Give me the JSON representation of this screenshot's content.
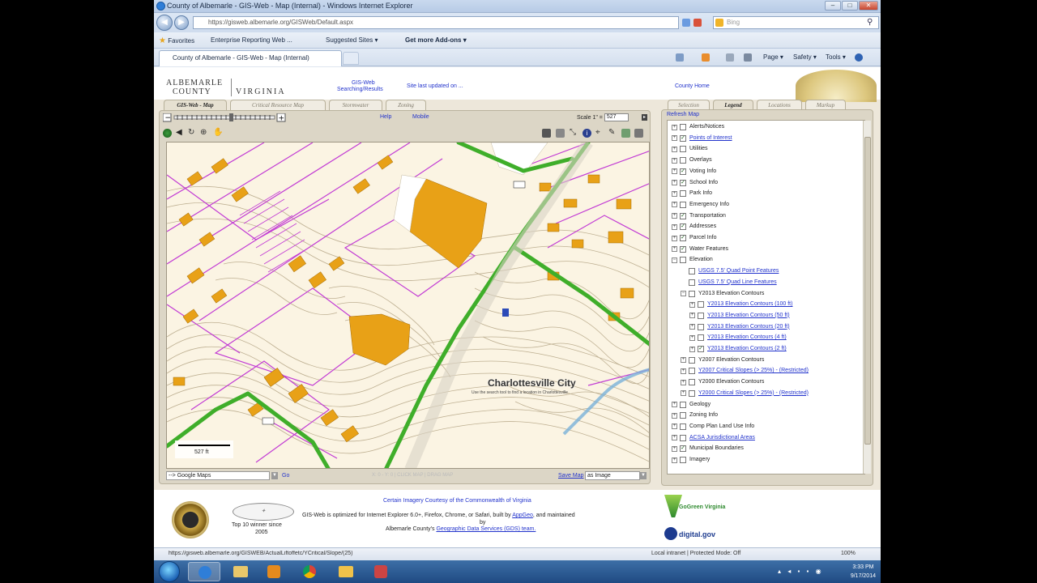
{
  "window": {
    "title": "County of Albemarle - GIS-Web - Map (Internal) - Windows Internet Explorer"
  },
  "browser": {
    "address": "https://gisweb.albemarle.org/GISWeb/Default.aspx",
    "address_domain": "albemarle.org",
    "search_placeholder": "Bing",
    "favorites_label": "Favorites",
    "favorites": [
      "Enterprise Reporting Web ...",
      "Suggested Sites ▾",
      "Get more Add-ons ▾"
    ],
    "tab_label": "County of Albemarle - GIS-Web - Map (Internal)",
    "commands": [
      "Page ▾",
      "Safety ▾",
      "Tools ▾"
    ]
  },
  "header": {
    "logo_line1": "ALBEMARLE",
    "logo_line2": "COUNTY",
    "logo_line3": "VIRGINIA",
    "link_gis": "GIS-Web",
    "link_results": "Searching/Results",
    "link_updated": "Site last updated on ...",
    "link_county_home": "County Home"
  },
  "left_tabs": [
    "GIS-Web - Map",
    "Critical Resource Map",
    "Stormwater",
    "Zoning"
  ],
  "right_tabs": [
    "Selection",
    "Legend",
    "Locations",
    "Markup"
  ],
  "map": {
    "help": "Help",
    "mobile": "Mobile",
    "scale_label": "Scale 1\" =",
    "scale_value": "527",
    "city_label": "Charlottesville City",
    "city_sublabel": "Use the search tool to find a location in Charlottesville",
    "scalebar_label": "527 ft",
    "basemap_select": "--> Google Maps",
    "go": "Go",
    "coords_hint": "X: 0 - Y: 0 | CLICK MAP | DRAG MAP",
    "save_map": "Save Map",
    "as_image": "as Image",
    "refresh_map": "Refresh Map"
  },
  "layers": [
    {
      "label": "Alerts/Notices",
      "indent": 0,
      "pm": "+",
      "checked": false,
      "link": false
    },
    {
      "label": "Points of Interest",
      "indent": 0,
      "pm": "+",
      "checked": true,
      "link": true
    },
    {
      "label": "Utilities",
      "indent": 0,
      "pm": "+",
      "checked": false,
      "link": false
    },
    {
      "label": "Overlays",
      "indent": 0,
      "pm": "+",
      "checked": false,
      "link": false
    },
    {
      "label": "Voting Info",
      "indent": 0,
      "pm": "+",
      "checked": true,
      "link": false
    },
    {
      "label": "School Info",
      "indent": 0,
      "pm": "+",
      "checked": true,
      "link": false
    },
    {
      "label": "Park Info",
      "indent": 0,
      "pm": "+",
      "checked": false,
      "link": false
    },
    {
      "label": "Emergency Info",
      "indent": 0,
      "pm": "+",
      "checked": false,
      "link": false
    },
    {
      "label": "Transportation",
      "indent": 0,
      "pm": "+",
      "checked": true,
      "link": false
    },
    {
      "label": "Addresses",
      "indent": 0,
      "pm": "+",
      "checked": true,
      "link": false
    },
    {
      "label": "Parcel Info",
      "indent": 0,
      "pm": "+",
      "checked": true,
      "link": false
    },
    {
      "label": "Water Features",
      "indent": 0,
      "pm": "+",
      "checked": true,
      "link": false
    },
    {
      "label": "Elevation",
      "indent": 0,
      "pm": "−",
      "checked": false,
      "link": false
    },
    {
      "label": "USGS 7.5' Quad Point Features",
      "indent": 1,
      "pm": "",
      "checked": false,
      "link": true
    },
    {
      "label": "USGS 7.5' Quad Line Features",
      "indent": 1,
      "pm": "",
      "checked": false,
      "link": true
    },
    {
      "label": "Y2013 Elevation Contours",
      "indent": 1,
      "pm": "−",
      "checked": false,
      "link": false
    },
    {
      "label": "Y2013 Elevation Contours (100 ft)",
      "indent": 2,
      "pm": "+",
      "checked": false,
      "link": true
    },
    {
      "label": "Y2013 Elevation Contours (50 ft)",
      "indent": 2,
      "pm": "+",
      "checked": false,
      "link": true
    },
    {
      "label": "Y2013 Elevation Contours (20 ft)",
      "indent": 2,
      "pm": "+",
      "checked": false,
      "link": true
    },
    {
      "label": "Y2013 Elevation Contours (4 ft)",
      "indent": 2,
      "pm": "+",
      "checked": false,
      "link": true
    },
    {
      "label": "Y2013 Elevation Contours (2 ft)",
      "indent": 2,
      "pm": "+",
      "checked": true,
      "link": true
    },
    {
      "label": "Y2007 Elevation Contours",
      "indent": 1,
      "pm": "+",
      "checked": false,
      "link": false
    },
    {
      "label": "Y2007 Critical Slopes (> 25%) - (Restricted)",
      "indent": 1,
      "pm": "+",
      "checked": false,
      "link": true
    },
    {
      "label": "Y2000 Elevation Contours",
      "indent": 1,
      "pm": "+",
      "checked": false,
      "link": false
    },
    {
      "label": "Y2000 Critical Slopes (> 25%) - (Restricted)",
      "indent": 1,
      "pm": "+",
      "checked": false,
      "link": true
    },
    {
      "label": "Geology",
      "indent": 0,
      "pm": "+",
      "checked": false,
      "link": false
    },
    {
      "label": "Zoning Info",
      "indent": 0,
      "pm": "+",
      "checked": false,
      "link": false
    },
    {
      "label": "Comp Plan Land Use Info",
      "indent": 0,
      "pm": "+",
      "checked": false,
      "link": false
    },
    {
      "label": "ACSA Jurisdictional Areas",
      "indent": 0,
      "pm": "+",
      "checked": false,
      "link": true
    },
    {
      "label": "Municipal Boundaries",
      "indent": 0,
      "pm": "+",
      "checked": true,
      "link": false
    },
    {
      "label": "Imagery",
      "indent": 0,
      "pm": "+",
      "checked": false,
      "link": false
    }
  ],
  "footer": {
    "imagery_credit": "Certain Imagery Courtesy of the Commonwealth of Virginia",
    "optimized": "GIS-Web is optimized for Internet Explorer 6.0+, Firefox, Chrome, or Safari, built by",
    "appgeo": "AppGeo",
    "and_maintained": ", and maintained",
    "by": "by",
    "county": "Albemarle County's",
    "gds": "Geographic Data Services (GDS) team.",
    "top10": "Top 10 winner since",
    "year": "2005",
    "govirginia": "GoGreen Virginia",
    "gov": "digital.gov"
  },
  "status": {
    "url": "https://gisweb.albemarle.org/GISWEB/ActualLiftoffetc/YCritical/Slope/(25)",
    "zone": "Local intranet | Protected Mode: Off",
    "zoom": "100%"
  },
  "taskbar": {
    "time": "3:33 PM",
    "date": "9/17/2014"
  },
  "colors": {
    "building": "#e8a117",
    "road_green": "#3fae2a",
    "parcel": "#c23bd4",
    "contour": "#b8a98a",
    "link": "#2233cc"
  }
}
